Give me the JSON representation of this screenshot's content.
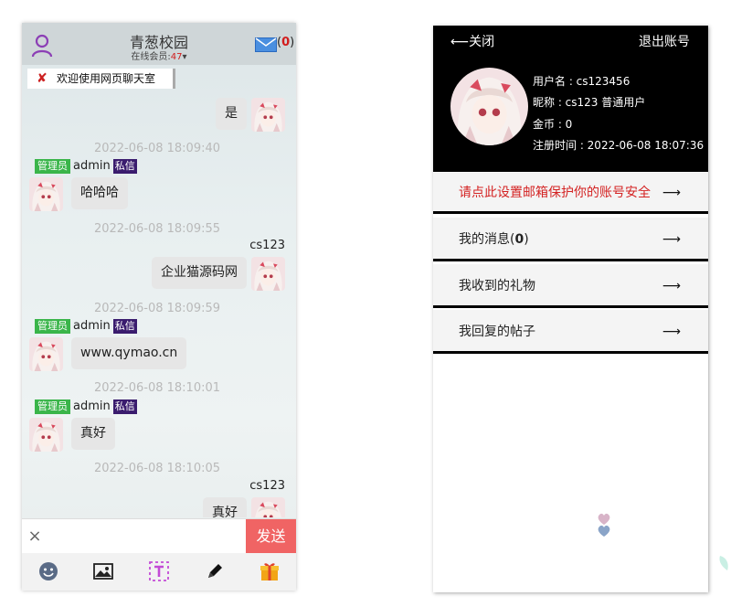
{
  "chat": {
    "title": "青葱校园",
    "online_label": "在线会员:",
    "online_count": "47",
    "online_arrow": "▾",
    "mail_open": "(",
    "mail_count": "0",
    "mail_close": ")",
    "welcome": "欢迎使用网页聊天室",
    "messages": [
      {
        "side": "right",
        "sender": "",
        "text": "是"
      },
      {
        "timestamp": "2022-06-08 18:09:40",
        "side": "left",
        "badge": "管理员",
        "sender": "admin",
        "pm": "私信",
        "text": "哈哈哈"
      },
      {
        "timestamp": "2022-06-08 18:09:55",
        "side": "right",
        "sender": "cs123",
        "text": "企业猫源码网"
      },
      {
        "timestamp": "2022-06-08 18:09:59",
        "side": "left",
        "badge": "管理员",
        "sender": "admin",
        "pm": "私信",
        "text": "www.qymao.cn"
      },
      {
        "timestamp": "2022-06-08 18:10:01",
        "side": "left",
        "badge": "管理员",
        "sender": "admin",
        "pm": "私信",
        "text": "真好"
      },
      {
        "timestamp": "2022-06-08 18:10:05",
        "side": "right",
        "sender": "cs123",
        "text": "真好"
      }
    ],
    "input_value": "",
    "clear_label": "×",
    "send_label": "发送",
    "toolbar": [
      "smile-icon",
      "image-icon",
      "text-icon",
      "pen-icon",
      "gift-icon"
    ]
  },
  "profile": {
    "close_label": "⟵关闭",
    "logout_label": "退出账号",
    "username_line": "用户名 : cs123456",
    "nickname_line": "昵称 : cs123 普通用户",
    "coins_line": "金币 : 0",
    "register_line": "注册时间 : 2022-06-08 18:07:36",
    "email_prompt": "请点此设置邮箱保护你的账号安全",
    "arrow": "⟶",
    "menu": [
      {
        "label_prefix": "我的消息(",
        "label_count": "0",
        "label_suffix": ")"
      },
      {
        "label": "我收到的礼物"
      },
      {
        "label": "我回复的帖子"
      }
    ]
  },
  "colors": {
    "send_button": "#f06464",
    "admin_badge": "#3ab54a",
    "pm_badge": "#3a1c6e",
    "email_prompt": "#d42323",
    "profile_header": "#000000"
  }
}
